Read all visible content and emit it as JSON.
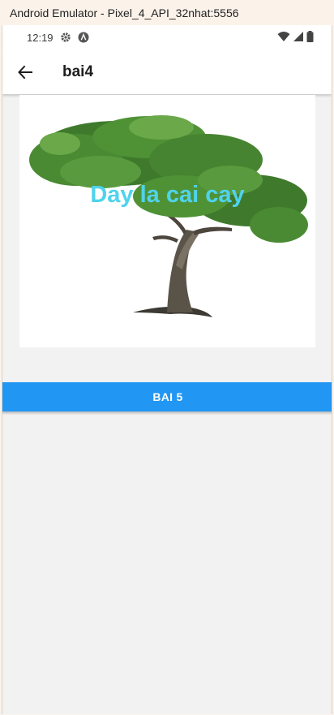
{
  "emulator": {
    "window_title": "Android Emulator - Pixel_4_API_32nhat:5556"
  },
  "statusbar": {
    "time": "12:19",
    "icons": [
      "gear-icon",
      "a-icon",
      "wifi-icon",
      "signal-icon",
      "battery-icon"
    ]
  },
  "appbar": {
    "title": "bai4",
    "back_icon": "arrow-back-icon"
  },
  "content": {
    "image_alt": "tree",
    "overlay_text": "Day la cai cay",
    "overlay_color": "#4fd3ec",
    "button_label": "BAI 5",
    "button_color": "#2196f3"
  }
}
